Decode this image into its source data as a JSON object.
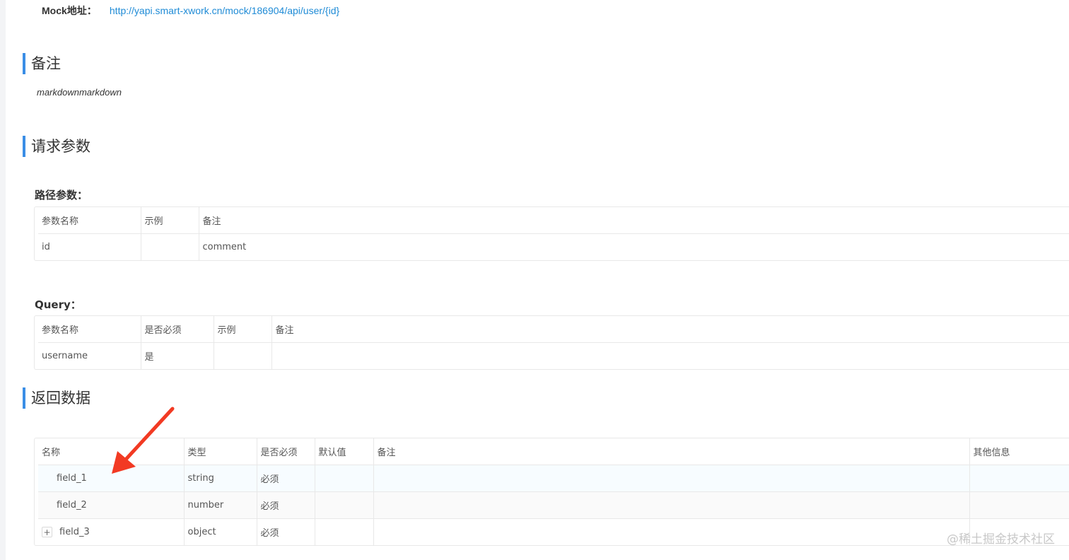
{
  "mock": {
    "label": "Mock地址：",
    "url": "http://yapi.smart-xwork.cn/mock/186904/api/user/{id}"
  },
  "remark_section": {
    "title": "备注",
    "text": "markdownmarkdown"
  },
  "request_section": {
    "title": "请求参数",
    "path_params": {
      "title": "路径参数：",
      "headers": [
        "参数名称",
        "示例",
        "备注"
      ],
      "rows": [
        {
          "name": "id",
          "example": "",
          "comment": "comment"
        }
      ]
    },
    "query": {
      "title": "Query：",
      "headers": [
        "参数名称",
        "是否必须",
        "示例",
        "备注"
      ],
      "rows": [
        {
          "name": "username",
          "required": "是",
          "example": "",
          "comment": ""
        }
      ]
    }
  },
  "response_section": {
    "title": "返回数据",
    "headers": [
      "名称",
      "类型",
      "是否必须",
      "默认值",
      "备注",
      "其他信息"
    ],
    "rows": [
      {
        "name": "field_1",
        "type": "string",
        "required": "必须",
        "default": "",
        "comment": "",
        "other": ""
      },
      {
        "name": "field_2",
        "type": "number",
        "required": "必须",
        "default": "",
        "comment": "",
        "other": ""
      },
      {
        "name": "field_3",
        "type": "object",
        "required": "必须",
        "default": "",
        "comment": "",
        "other": "",
        "expand_symbol": "+"
      }
    ]
  },
  "annotation": {
    "arrow_color": "#f23a23"
  },
  "watermark": "@稀土掘金技术社区"
}
